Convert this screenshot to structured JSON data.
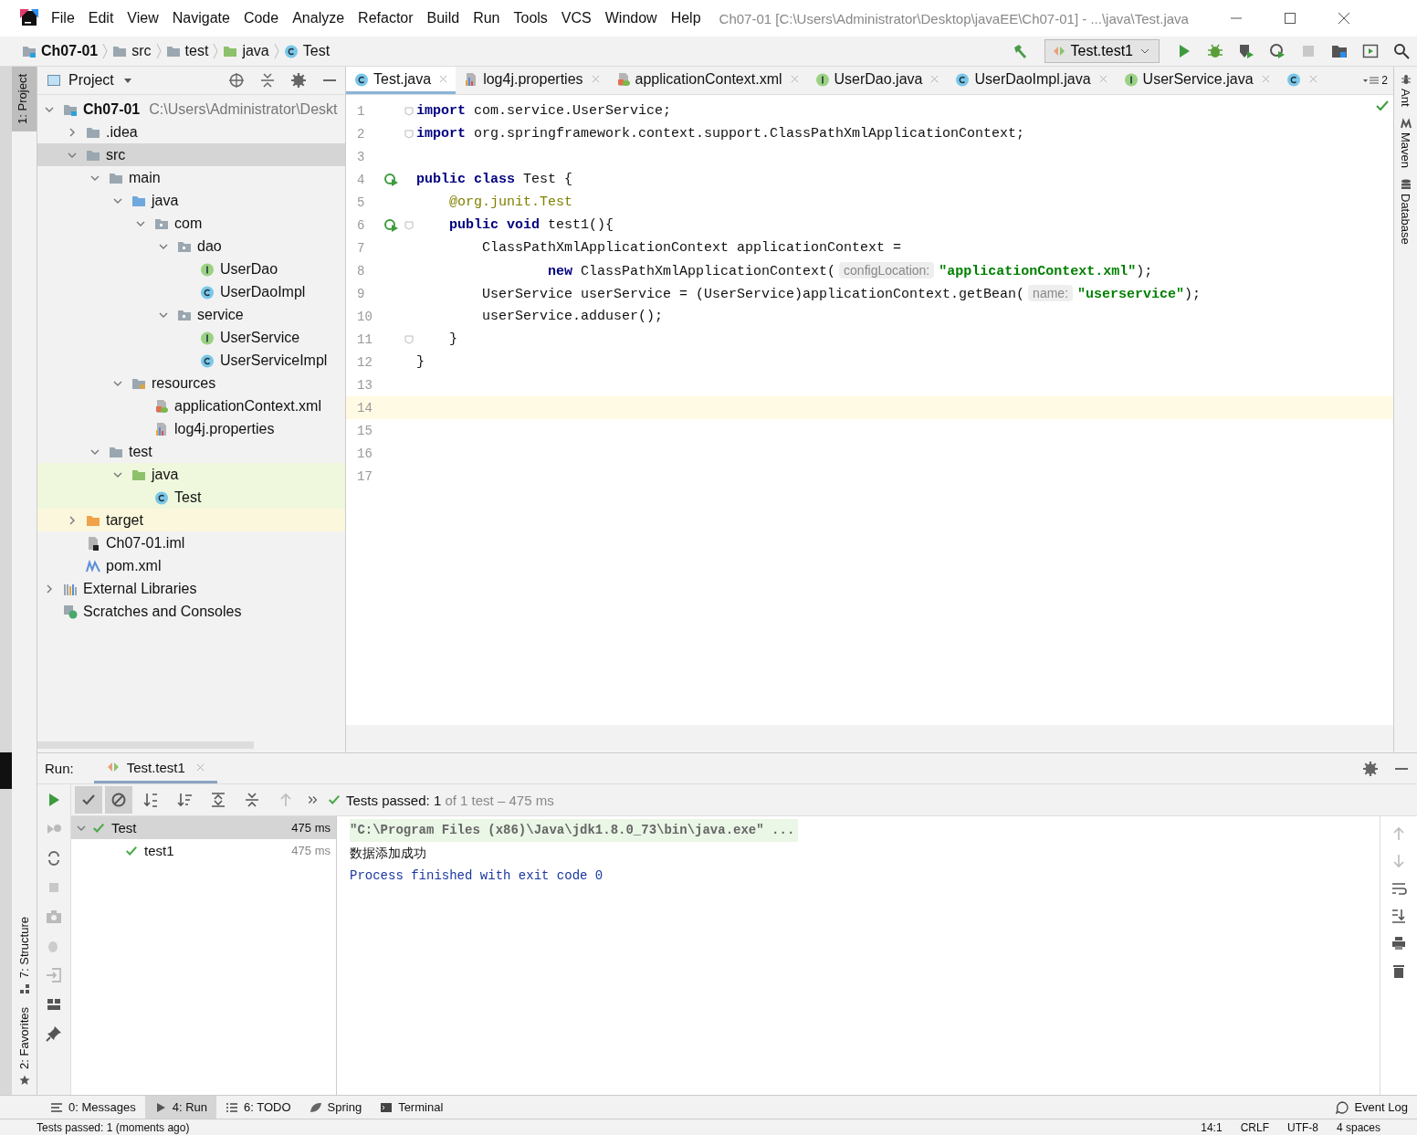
{
  "menu": [
    "File",
    "Edit",
    "View",
    "Navigate",
    "Code",
    "Analyze",
    "Refactor",
    "Build",
    "Run",
    "Tools",
    "VCS",
    "Window",
    "Help"
  ],
  "window_title": "Ch07-01 [C:\\Users\\Administrator\\Desktop\\javaEE\\Ch07-01] - ...\\java\\Test.java",
  "breadcrumbs": [
    {
      "label": "Ch07-01",
      "kind": "project"
    },
    {
      "label": "src",
      "kind": "folder"
    },
    {
      "label": "test",
      "kind": "folder"
    },
    {
      "label": "java",
      "kind": "test-folder"
    },
    {
      "label": "Test",
      "kind": "class"
    }
  ],
  "run_config": "Test.test1",
  "left_tool_windows": [
    {
      "label": "1: Project",
      "selected": true
    }
  ],
  "left_bottom_tool_windows": [
    {
      "label": "7: Structure",
      "kind": "structure"
    },
    {
      "label": "2: Favorites",
      "kind": "favorites"
    }
  ],
  "right_tool_windows": [
    {
      "label": "Ant",
      "kind": "ant"
    },
    {
      "label": "Maven",
      "kind": "maven"
    },
    {
      "label": "Database",
      "kind": "database"
    }
  ],
  "project_panel": {
    "title": "Project",
    "tree": [
      {
        "name": "Ch07-01",
        "path": "C:\\Users\\Administrator\\Deskt",
        "kind": "project",
        "expanded": true,
        "selected": false,
        "children": [
          {
            "name": ".idea",
            "kind": "folder",
            "expanded": false,
            "selected": false
          },
          {
            "name": "src",
            "kind": "folder",
            "expanded": true,
            "selected": true,
            "children": [
              {
                "name": "main",
                "kind": "folder",
                "expanded": true,
                "selected": false,
                "children": [
                  {
                    "name": "java",
                    "kind": "source-folder",
                    "expanded": true,
                    "selected": false,
                    "children": [
                      {
                        "name": "com",
                        "kind": "package",
                        "expanded": true,
                        "selected": false,
                        "children": [
                          {
                            "name": "dao",
                            "kind": "package",
                            "expanded": true,
                            "selected": false,
                            "children": [
                              {
                                "name": "UserDao",
                                "kind": "interface",
                                "selected": false
                              },
                              {
                                "name": "UserDaoImpl",
                                "kind": "class",
                                "selected": false
                              }
                            ]
                          },
                          {
                            "name": "service",
                            "kind": "package",
                            "expanded": true,
                            "selected": false,
                            "children": [
                              {
                                "name": "UserService",
                                "kind": "interface",
                                "selected": false
                              },
                              {
                                "name": "UserServiceImpl",
                                "kind": "class",
                                "selected": false
                              }
                            ]
                          }
                        ]
                      }
                    ]
                  },
                  {
                    "name": "resources",
                    "kind": "resources-folder",
                    "expanded": true,
                    "selected": false,
                    "children": [
                      {
                        "name": "applicationContext.xml",
                        "kind": "xml",
                        "selected": false
                      },
                      {
                        "name": "log4j.properties",
                        "kind": "properties",
                        "selected": false
                      }
                    ]
                  }
                ]
              },
              {
                "name": "test",
                "kind": "folder",
                "expanded": true,
                "selected": false,
                "children": [
                  {
                    "name": "java",
                    "kind": "test-folder",
                    "color": "#eff7dc",
                    "expanded": true,
                    "selected": false,
                    "children": [
                      {
                        "name": "Test",
                        "kind": "class",
                        "color": "#eff7dc",
                        "selected": false
                      }
                    ]
                  }
                ]
              }
            ]
          },
          {
            "name": "target",
            "kind": "excluded-folder",
            "color": "#fbf7dc",
            "expanded": false,
            "selected": false
          },
          {
            "name": "Ch07-01.iml",
            "kind": "module",
            "selected": false
          },
          {
            "name": "pom.xml",
            "kind": "maven",
            "selected": false
          }
        ]
      },
      {
        "name": "External Libraries",
        "kind": "libraries",
        "expanded": false,
        "selected": false
      },
      {
        "name": "Scratches and Consoles",
        "kind": "scratches",
        "selected": false
      }
    ]
  },
  "editor_tabs": [
    {
      "label": "Test.java",
      "kind": "class",
      "selected": true
    },
    {
      "label": "log4j.properties",
      "kind": "properties",
      "selected": false
    },
    {
      "label": "applicationContext.xml",
      "kind": "xml",
      "selected": false
    },
    {
      "label": "UserDao.java",
      "kind": "interface",
      "selected": false
    },
    {
      "label": "UserDaoImpl.java",
      "kind": "class",
      "selected": false
    },
    {
      "label": "UserService.java",
      "kind": "interface",
      "selected": false
    },
    {
      "kind": "class",
      "selected": false
    }
  ],
  "tab_overflow": "2",
  "code": [
    {
      "number": "1",
      "fold": true,
      "tokens": [
        {
          "t": "import",
          "kind": "keyword"
        },
        {
          "t": " com.service.UserService;",
          "kind": "plain"
        }
      ]
    },
    {
      "number": "2",
      "fold": true,
      "tokens": [
        {
          "t": "import",
          "kind": "keyword"
        },
        {
          "t": " org.springframework.context.support.ClassPathXmlApplicationContext;",
          "kind": "plain"
        }
      ]
    },
    {
      "number": "3"
    },
    {
      "number": "4",
      "run": true,
      "tokens": [
        {
          "t": "public class",
          "kind": "keyword"
        },
        {
          "t": " Test {",
          "kind": "plain"
        }
      ]
    },
    {
      "number": "5",
      "tokens": [
        {
          "t": "    @org.junit.Test",
          "kind": "annotation"
        }
      ]
    },
    {
      "number": "6",
      "run": true,
      "fold": true,
      "tokens": [
        {
          "t": "    public void",
          "kind": "keyword"
        },
        {
          "t": " test1(){",
          "kind": "plain"
        }
      ]
    },
    {
      "number": "7",
      "tokens": [
        {
          "t": "        ClassPathXmlApplicationContext applicationContext =",
          "kind": "plain"
        }
      ]
    },
    {
      "number": "8",
      "tokens": [
        {
          "t": "                new",
          "kind": "keyword"
        },
        {
          "t": " ClassPathXmlApplicationContext(",
          "kind": "plain"
        },
        {
          "t": "configLocation:",
          "kind": "hint"
        },
        {
          "t": "\"applicationContext.xml\"",
          "kind": "string"
        },
        {
          "t": ");",
          "kind": "plain"
        }
      ]
    },
    {
      "number": "9",
      "tokens": [
        {
          "t": "        UserService userService = (UserService)applicationContext.getBean(",
          "kind": "plain"
        },
        {
          "t": "name:",
          "kind": "hint"
        },
        {
          "t": "\"userservice\"",
          "kind": "string"
        },
        {
          "t": ");",
          "kind": "plain"
        }
      ]
    },
    {
      "number": "10",
      "tokens": [
        {
          "t": "        userService.adduser();",
          "kind": "plain"
        }
      ]
    },
    {
      "number": "11",
      "fold": true,
      "tokens": [
        {
          "t": "    }",
          "kind": "plain"
        }
      ]
    },
    {
      "number": "12",
      "tokens": [
        {
          "t": "}",
          "kind": "plain"
        }
      ]
    },
    {
      "number": "13"
    },
    {
      "number": "14",
      "current": true
    },
    {
      "number": "15"
    },
    {
      "number": "16"
    },
    {
      "number": "17"
    }
  ],
  "run_panel": {
    "label": "Run:",
    "tab": "Test.test1",
    "filters": [
      {
        "kind": "show-passed",
        "selected": true
      },
      {
        "kind": "show-ignored",
        "selected": true
      }
    ],
    "status": {
      "label": "Tests passed:",
      "count": "1",
      "detail": "of 1 test – 475 ms"
    },
    "tests": [
      {
        "name": "Test",
        "time": "475 ms",
        "selected": true,
        "expanded": true,
        "children": [
          {
            "name": "test1",
            "time": "475 ms",
            "selected": false
          }
        ]
      }
    ],
    "console": [
      {
        "text": "\"C:\\Program Files (x86)\\Java\\jdk1.8.0_73\\bin\\java.exe\" ...",
        "kind": "command"
      },
      {
        "text": "数据添加成功",
        "kind": "output"
      },
      {
        "text": "Process finished with exit code 0",
        "kind": "info"
      }
    ]
  },
  "bottom_tabs": [
    {
      "label": "0: Messages",
      "kind": "messages",
      "selected": false
    },
    {
      "label": "4: Run",
      "kind": "run",
      "selected": true
    },
    {
      "label": "6: TODO",
      "kind": "todo",
      "selected": false
    },
    {
      "label": "Spring",
      "kind": "spring",
      "selected": false
    },
    {
      "label": "Terminal",
      "kind": "terminal",
      "selected": false
    }
  ],
  "event_log": "Event Log",
  "status_bar": {
    "message": "Tests passed: 1 (moments ago)",
    "position": "14:1",
    "line_separator": "CRLF",
    "encoding": "UTF-8",
    "indent": "4 spaces"
  }
}
